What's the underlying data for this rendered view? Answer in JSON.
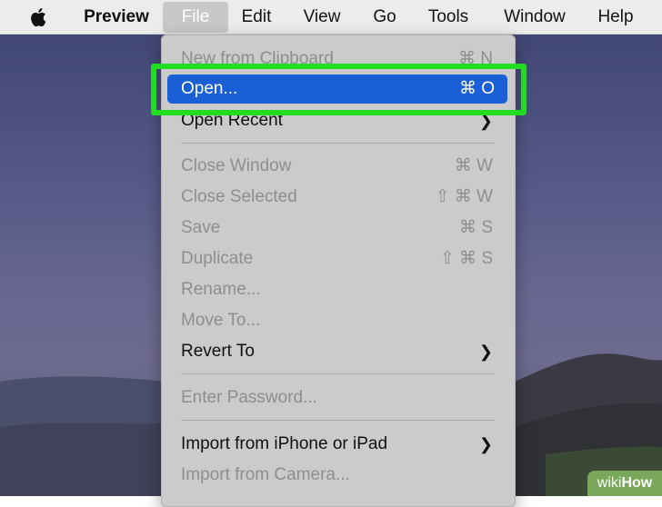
{
  "menubar": {
    "items": [
      "Preview",
      "File",
      "Edit",
      "View",
      "Go",
      "Tools",
      "Window",
      "Help"
    ],
    "active": "File"
  },
  "file_menu": {
    "new_from_clipboard": {
      "label": "New from Clipboard",
      "shortcut": "⌘ N"
    },
    "open": {
      "label": "Open...",
      "shortcut": "⌘ O"
    },
    "open_recent": {
      "label": "Open Recent"
    },
    "close_window": {
      "label": "Close Window",
      "shortcut": "⌘ W"
    },
    "close_selected": {
      "label": "Close Selected",
      "shortcut": "⇧ ⌘ W"
    },
    "save": {
      "label": "Save",
      "shortcut": "⌘ S"
    },
    "duplicate": {
      "label": "Duplicate",
      "shortcut": "⇧ ⌘ S"
    },
    "rename": {
      "label": "Rename..."
    },
    "move_to": {
      "label": "Move To..."
    },
    "revert_to": {
      "label": "Revert To"
    },
    "enter_password": {
      "label": "Enter Password..."
    },
    "import_iphone": {
      "label": "Import from iPhone or iPad"
    },
    "import_camera": {
      "label": "Import from Camera..."
    }
  },
  "watermark": {
    "prefix": "wiki",
    "suffix": "How"
  },
  "colors": {
    "highlight": "#1b5fd6",
    "annotation_box": "#21dc21",
    "menu_bg": "#cbcbcb"
  }
}
